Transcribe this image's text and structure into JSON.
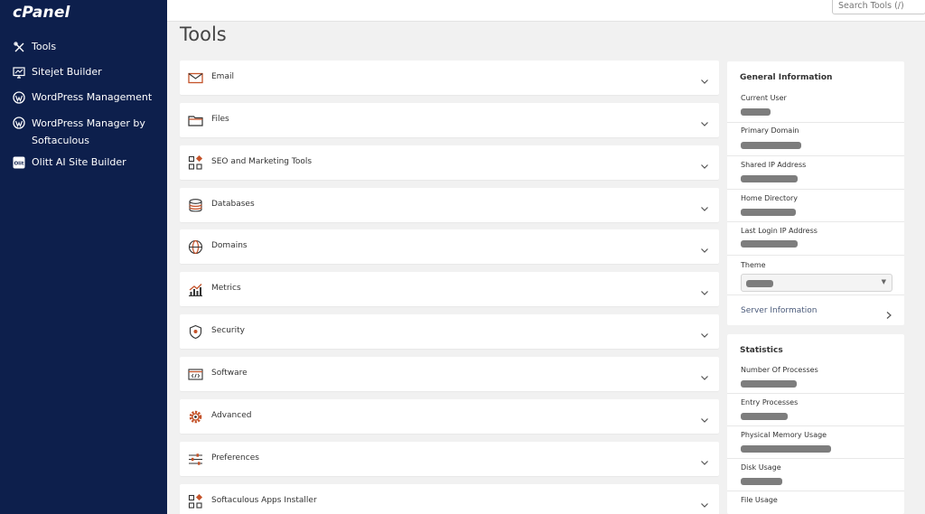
{
  "brand": {
    "logo_text": "cPanel"
  },
  "sidebar": {
    "items": [
      {
        "label": "Tools",
        "icon": "tools-icon"
      },
      {
        "label": "Sitejet Builder",
        "icon": "monitor-icon"
      },
      {
        "label": "WordPress Management",
        "icon": "wordpress-icon"
      },
      {
        "label": "WordPress Manager by Softaculous",
        "icon": "wordpress-icon"
      },
      {
        "label": "Olitt AI Site Builder",
        "icon": "olitt-icon"
      }
    ]
  },
  "search": {
    "placeholder": "Search Tools (/)"
  },
  "page": {
    "title": "Tools"
  },
  "groups": [
    {
      "label": "Email",
      "icon": "email-icon"
    },
    {
      "label": "Files",
      "icon": "folder-icon"
    },
    {
      "label": "SEO and Marketing Tools",
      "icon": "seo-icon"
    },
    {
      "label": "Databases",
      "icon": "database-icon"
    },
    {
      "label": "Domains",
      "icon": "globe-icon"
    },
    {
      "label": "Metrics",
      "icon": "metrics-icon"
    },
    {
      "label": "Security",
      "icon": "shield-icon"
    },
    {
      "label": "Software",
      "icon": "software-icon"
    },
    {
      "label": "Advanced",
      "icon": "gear-icon"
    },
    {
      "label": "Preferences",
      "icon": "sliders-icon"
    },
    {
      "label": "Softaculous Apps Installer",
      "icon": "softaculous-icon"
    }
  ],
  "general_info": {
    "title": "General Information",
    "rows": [
      {
        "label": "Current User"
      },
      {
        "label": "Primary Domain"
      },
      {
        "label": "Shared IP Address"
      },
      {
        "label": "Home Directory"
      },
      {
        "label": "Last Login IP Address"
      },
      {
        "label": "Theme"
      }
    ],
    "server_info_label": "Server Information"
  },
  "statistics": {
    "title": "Statistics",
    "rows": [
      {
        "label": "Number Of Processes"
      },
      {
        "label": "Entry Processes"
      },
      {
        "label": "Physical Memory Usage"
      },
      {
        "label": "Disk Usage"
      },
      {
        "label": "File Usage"
      }
    ]
  },
  "colors": {
    "sidebar_bg": "#0d1f4c",
    "accent_icon": "#c4532a",
    "page_bg": "#f1f1f1"
  }
}
